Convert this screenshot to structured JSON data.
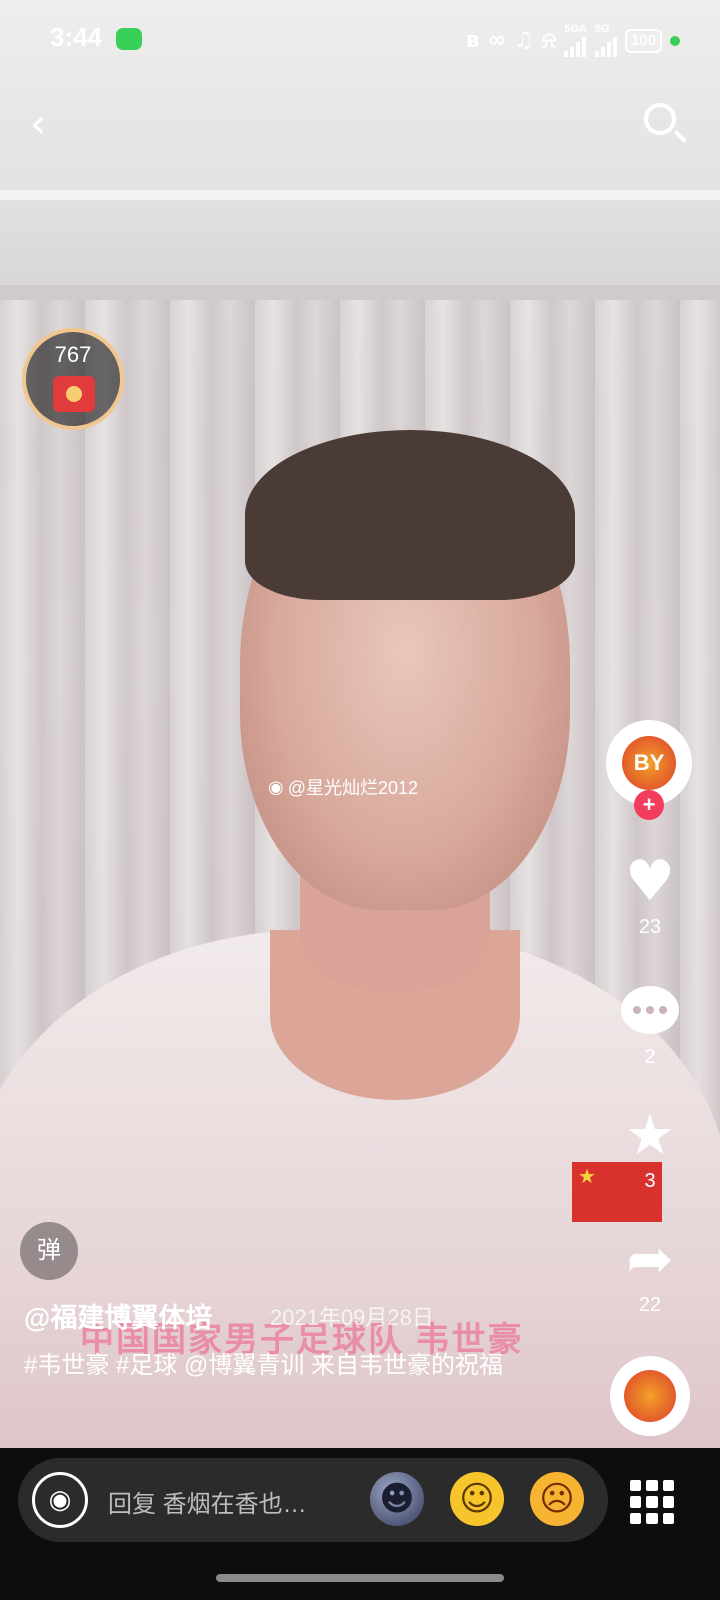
{
  "status_bar": {
    "time": "3:44",
    "network_1": "5GA",
    "network_2": "5G",
    "battery": "100"
  },
  "nav": {
    "back_icon": "chevron-left-icon",
    "search_icon": "search-icon"
  },
  "red_packet": {
    "count": "767"
  },
  "watermark": {
    "text": "@星光灿烂2012"
  },
  "actions": {
    "avatar_logo_text": "BY",
    "likes": "23",
    "comments": "2",
    "favorites": "3",
    "shares": "22"
  },
  "danmaku_label": "弹",
  "caption": {
    "author": "@福建博翼体培",
    "date": "2021年09月28日",
    "video_subtitle": "中国国家男子足球队 韦世豪",
    "description": "#韦世豪 #足球 @博翼青训 来自韦世豪的祝福"
  },
  "bottom_bar": {
    "reply_placeholder": "回复 香烟在香也…",
    "emojis": [
      "moon-face-emoji",
      "pleading-face-emoji",
      "angry-face-emoji"
    ],
    "more_icon": "grid-icon"
  },
  "colors": {
    "like_accent": "#f23d5c",
    "status_green": "#39d05a"
  }
}
